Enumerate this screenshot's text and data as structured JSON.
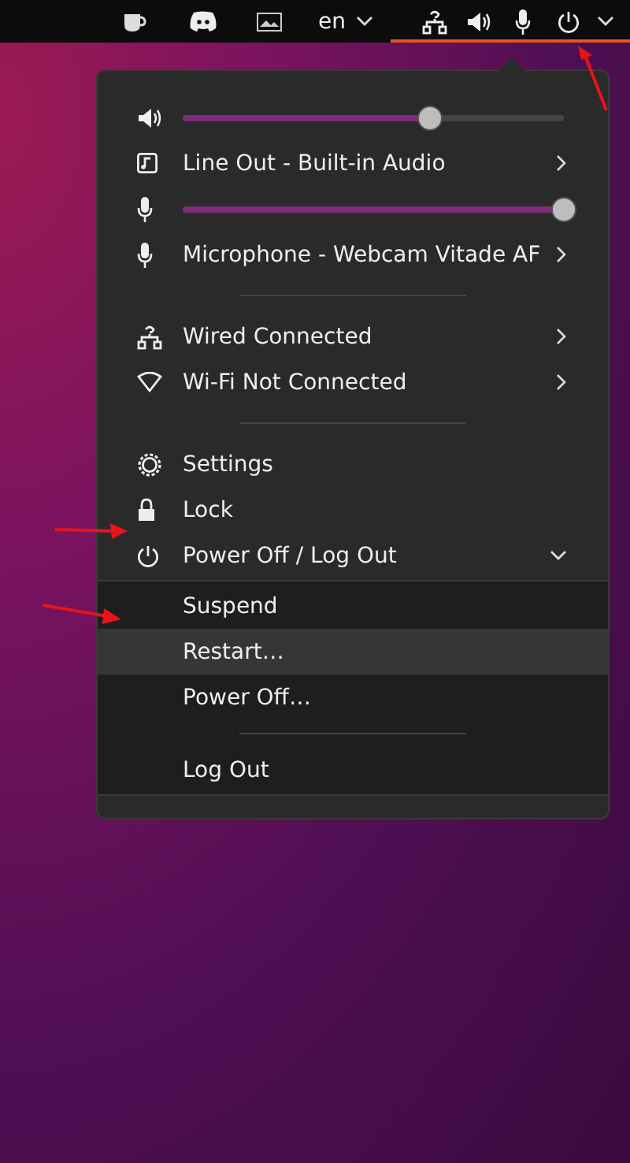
{
  "top_bar": {
    "items": [
      {
        "kind": "cup"
      },
      {
        "kind": "chat"
      },
      {
        "kind": "image"
      },
      {
        "kind": "language",
        "label": "en"
      },
      {
        "kind": "network"
      },
      {
        "kind": "speaker"
      },
      {
        "kind": "mic"
      },
      {
        "kind": "power"
      },
      {
        "kind": "caret"
      }
    ]
  },
  "menu": {
    "sections": [
      {
        "items": [
          {
            "kind": "slider",
            "level": 0.65
          },
          {
            "kind": "submenu",
            "label": "Line Out - Built-in Audio"
          },
          {
            "kind": "slider",
            "level": 1
          },
          {
            "kind": "submenu",
            "label": "Microphone - Webcam Vitade AF"
          }
        ]
      },
      {
        "items": [
          {
            "kind": "submenu",
            "label": "Wired Connected"
          },
          {
            "kind": "submenu",
            "label": "Wi-Fi Not Connected"
          }
        ]
      },
      {
        "items": [
          {
            "kind": "action",
            "label": "Settings"
          },
          {
            "kind": "action",
            "label": "Lock"
          },
          {
            "kind": "expander",
            "label": "Power Off / Log Out",
            "expanded": true,
            "children": [
              {
                "kind": "action",
                "label": "Suspend",
                "selected": false
              },
              {
                "kind": "action",
                "label": "Restart…",
                "selected": true
              },
              {
                "kind": "action",
                "label": "Power Off…",
                "selected": false
              },
              {
                "kind": "separator"
              },
              {
                "kind": "action",
                "label": "Log Out",
                "selected": false
              }
            ]
          }
        ]
      }
    ]
  }
}
